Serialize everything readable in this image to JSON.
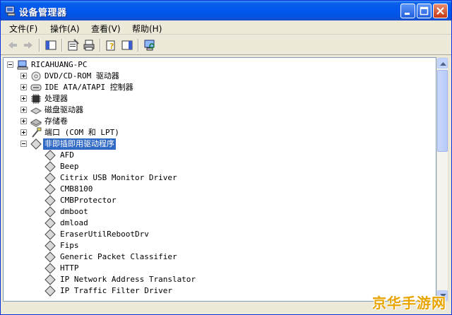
{
  "window": {
    "title": "设备管理器"
  },
  "menu": [
    "文件(F)",
    "操作(A)",
    "查看(V)",
    "帮助(H)"
  ],
  "toolbar": [
    "back-icon",
    "forward-icon",
    "show-hide-console-tree-icon",
    "properties-icon",
    "print-icon",
    "help-icon",
    "show-hide-action-pane-icon",
    "scan-hardware-icon"
  ],
  "tree": {
    "root": "RICAHUANG-PC",
    "categories": [
      {
        "label": "DVD/CD-ROM 驱动器",
        "icon": "cdrom-icon"
      },
      {
        "label": "IDE ATA/ATAPI 控制器",
        "icon": "ide-controller-icon"
      },
      {
        "label": "处理器",
        "icon": "processor-icon"
      },
      {
        "label": "磁盘驱动器",
        "icon": "disk-drive-icon"
      },
      {
        "label": "存储卷",
        "icon": "storage-volume-icon"
      },
      {
        "label": "端口 (COM 和 LPT)",
        "icon": "port-icon"
      }
    ],
    "expanded": {
      "label": "非即插即用驱动程序",
      "children": [
        "AFD",
        "Beep",
        "Citrix USB Monitor Driver",
        "CMB8100",
        "CMBProtector",
        "dmboot",
        "dmload",
        "EraserUtilRebootDrv",
        "Fips",
        "Generic Packet Classifier",
        "HTTP",
        "IP Network Address Translator",
        "IP Traffic Filter Driver"
      ]
    }
  },
  "watermark": "京华手游网"
}
